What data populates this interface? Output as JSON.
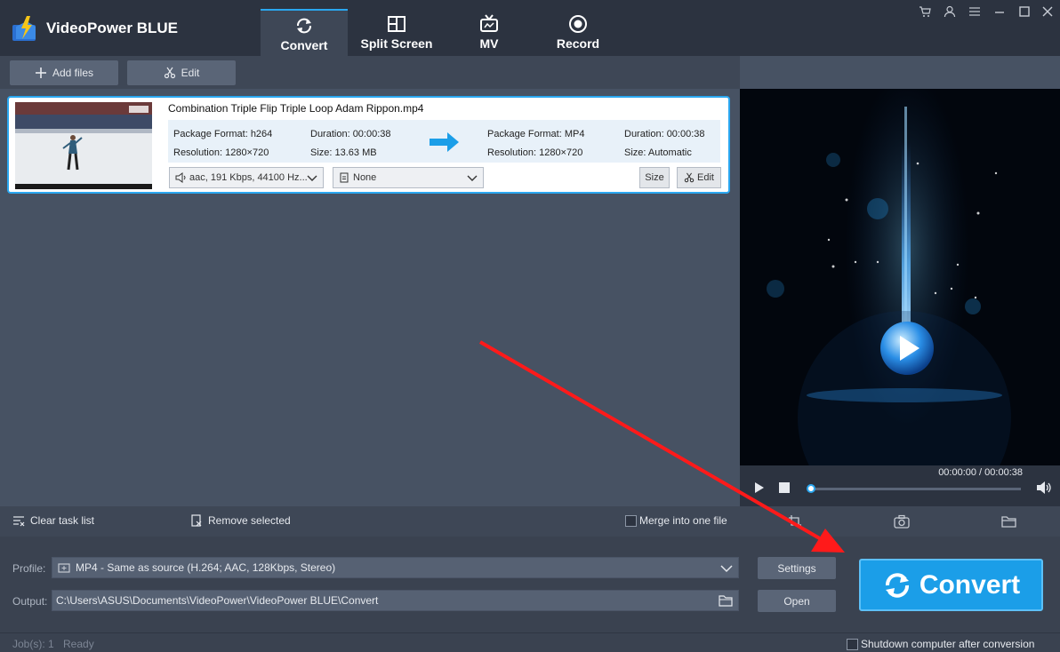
{
  "app": {
    "title": "VideoPower BLUE"
  },
  "nav": {
    "tabs": [
      {
        "label": "Convert",
        "icon": "refresh-icon",
        "active": true
      },
      {
        "label": "Split Screen",
        "icon": "split-screen-icon"
      },
      {
        "label": "MV",
        "icon": "tv-icon"
      },
      {
        "label": "Record",
        "icon": "record-icon"
      }
    ]
  },
  "window_controls": [
    "cart-icon",
    "user-icon",
    "menu-icon",
    "minimize-icon",
    "maximize-icon",
    "close-icon"
  ],
  "toolbar": {
    "add_files": "Add files",
    "edit": "Edit"
  },
  "file": {
    "name": "Combination Triple Flip Triple Loop Adam Rippon.mp4",
    "source": {
      "package_format": "Package Format: h264",
      "duration": "Duration: 00:00:38",
      "resolution": "Resolution: 1280×720",
      "size": "Size: 13.63 MB"
    },
    "target": {
      "package_format": "Package Format: MP4",
      "duration": "Duration: 00:00:38",
      "resolution": "Resolution: 1280×720",
      "size": "Size: Automatic"
    },
    "audio_track": "aac, 191 Kbps, 44100 Hz...",
    "subtitle": "None",
    "size_button": "Size",
    "edit_button": "Edit"
  },
  "player": {
    "time": "00:00:00 / 00:00:38",
    "progress": 0.0
  },
  "taskbar": {
    "clear": "Clear task list",
    "remove": "Remove selected",
    "merge": "Merge into one file"
  },
  "settings": {
    "profile_label": "Profile:",
    "profile_value": "MP4 - Same as source (H.264; AAC, 128Kbps, Stereo)",
    "output_label": "Output:",
    "output_value": "C:\\Users\\ASUS\\Documents\\VideoPower\\VideoPower BLUE\\Convert",
    "settings_button": "Settings",
    "open_button": "Open",
    "convert_button": "Convert"
  },
  "status": {
    "jobs": "Job(s): 1",
    "state": "Ready",
    "shutdown": "Shutdown computer after conversion"
  },
  "colors": {
    "accent": "#1b9ee8",
    "annotation": "#ff1a1a"
  }
}
